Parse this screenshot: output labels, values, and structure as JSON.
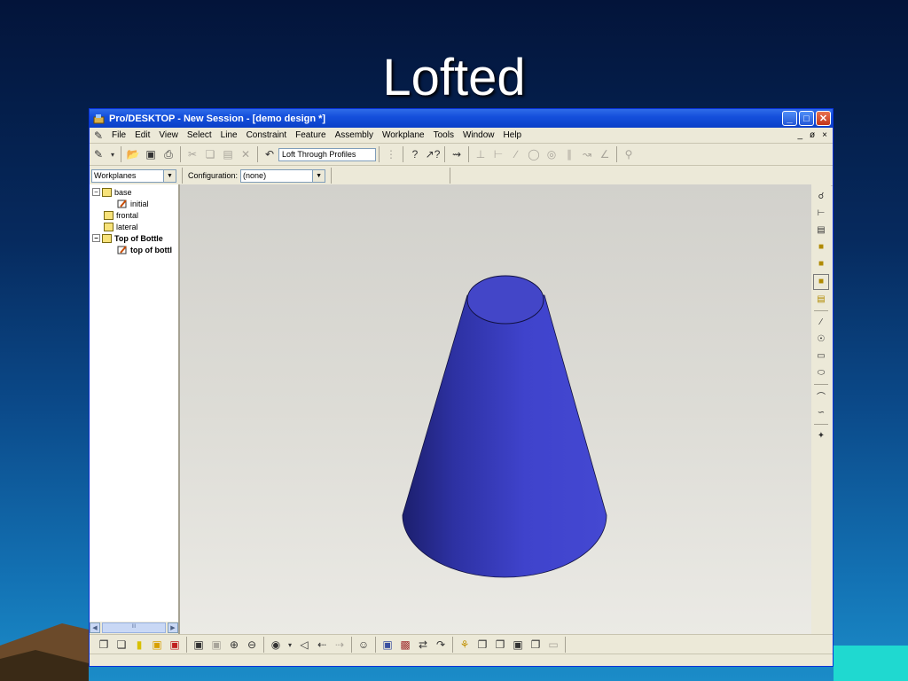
{
  "slide": {
    "title": "Lofted"
  },
  "window": {
    "title": "Pro/DESKTOP - New Session - [demo design *]",
    "menu": [
      "File",
      "Edit",
      "View",
      "Select",
      "Line",
      "Constraint",
      "Feature",
      "Assembly",
      "Workplane",
      "Tools",
      "Window",
      "Help"
    ],
    "mdi_controls": [
      "_",
      "ø",
      "×"
    ],
    "command_box": "Loft Through Profiles",
    "workplanes_dropdown": "Workplanes",
    "configuration_label": "Configuration:",
    "configuration_value": "(none)"
  },
  "tree": {
    "items": [
      {
        "label": "base",
        "kind": "workplane",
        "expand": "−"
      },
      {
        "label": "initial",
        "kind": "sketch"
      },
      {
        "label": "frontal",
        "kind": "workplane"
      },
      {
        "label": "lateral",
        "kind": "workplane"
      },
      {
        "label": "Top of Bottle",
        "kind": "workplane",
        "expand": "−",
        "bold": true
      },
      {
        "label": "top of bottl",
        "kind": "sketch",
        "bold": true
      }
    ],
    "scroll_thumb": "III"
  },
  "model": {
    "shape": "lofted cone",
    "color": "#3c40c8"
  },
  "icons": {
    "toolbar": [
      "select-pointer-icon",
      "open-icon",
      "save-icon",
      "print-icon",
      "cut-icon",
      "copy-icon",
      "paste-icon",
      "delete-icon",
      "undo-icon",
      "help-icon",
      "whats-this-icon",
      "sketch-tool-icon",
      "constraint-icon",
      "dimension-icon",
      "line-icon",
      "circle-icon",
      "center-icon",
      "parallel-icon",
      "tangent-icon",
      "angle-icon",
      "find-icon"
    ],
    "right": [
      "new-workplane-icon",
      "sketch-icon",
      "workplane-offset-icon",
      "extrude-icon",
      "revolve-icon",
      "loft-icon",
      "sweep-icon",
      "line-draw-icon",
      "circle-draw-icon",
      "rectangle-draw-icon",
      "ellipse-draw-icon",
      "arc-icon",
      "spline-icon",
      "trim-icon"
    ],
    "bottom": [
      "iso-view-icon",
      "wire-view-icon",
      "hidden-view-icon",
      "shaded-view-icon",
      "render-view-icon",
      "fit-view-icon",
      "zoom-window-icon",
      "zoom-in-icon",
      "zoom-out-icon",
      "orient-icon",
      "view-left-icon",
      "view-back-icon",
      "view-forward-icon",
      "smiley-icon",
      "part-icon",
      "assembly-icon",
      "explode-icon",
      "pipe-icon",
      "material-icon",
      "component-icon",
      "subassembly-icon",
      "box-icon",
      "shape-icon",
      "bottle-icon"
    ]
  }
}
